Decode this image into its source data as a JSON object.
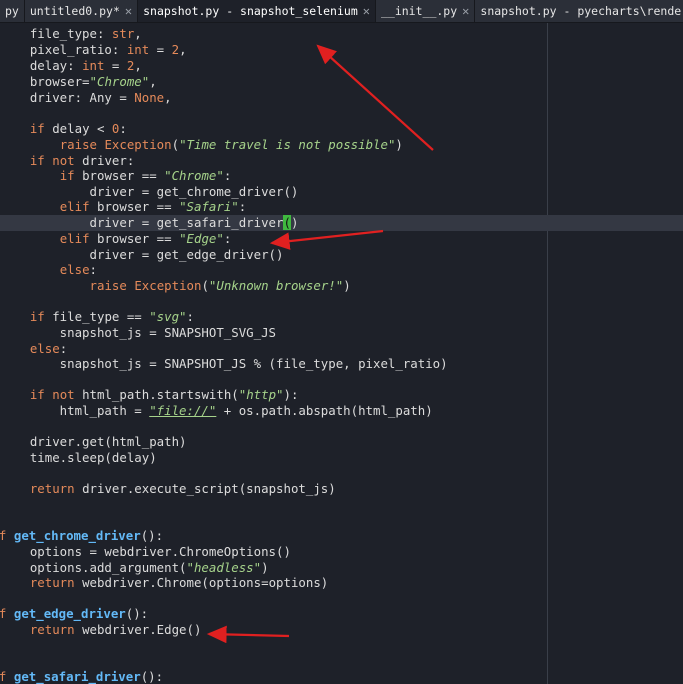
{
  "tabs": [
    {
      "label": "py",
      "active": false
    },
    {
      "label": "untitled0.py*",
      "active": false
    },
    {
      "label": "snapshot.py - snapshot_selenium",
      "active": true
    },
    {
      "label": "__init__.py",
      "active": false
    },
    {
      "label": "snapshot.py - pyecharts\\render",
      "active": false
    }
  ],
  "close_glyph": "✕",
  "colors": {
    "background": "#1e2129",
    "keyword": "#e58a5a",
    "function_name": "#63b9f7",
    "string": "#a6d38b",
    "text": "#dcdcdc",
    "annotation_arrow": "#e02020"
  },
  "code": {
    "l1": {
      "pre": "    file_type: ",
      "k1": "str",
      "post": ","
    },
    "l2": {
      "pre": "    pixel_ratio: ",
      "k1": "int",
      "mid": " = ",
      "n1": "2",
      "post": ","
    },
    "l3": {
      "pre": "    delay: ",
      "k1": "int",
      "mid": " = ",
      "n1": "2",
      "post": ","
    },
    "l4": {
      "pre": "    browser=",
      "s1": "\"Chrome\"",
      "post": ","
    },
    "l5": {
      "pre": "    driver: Any = ",
      "k1": "None",
      "post": ","
    },
    "l6": {
      "pre": "):"
    },
    "l7": {
      "pre": "    ",
      "k1": "if",
      "mid": " delay < ",
      "n1": "0",
      "post": ":"
    },
    "l8": {
      "pre": "        ",
      "k1": "raise",
      "mid": " ",
      "k2": "Exception",
      "mid2": "(",
      "s1": "\"Time travel is not possible\"",
      "post": ")"
    },
    "l9": {
      "pre": "    ",
      "k1": "if",
      "mid": " ",
      "k2": "not",
      "post": " driver:"
    },
    "l10": {
      "pre": "        ",
      "k1": "if",
      "mid": " browser == ",
      "s1": "\"Chrome\"",
      "post": ":"
    },
    "l11": {
      "pre": "            driver = get_chrome_driver()"
    },
    "l12": {
      "pre": "        ",
      "k1": "elif",
      "mid": " browser == ",
      "s1": "\"Safari\"",
      "post": ":"
    },
    "l13": {
      "pre": "            driver = get_safari_driver",
      "match": "(",
      "post": ")"
    },
    "l14": {
      "pre": "        ",
      "k1": "elif",
      "mid": " browser == ",
      "s1": "\"Edge\"",
      "post": ":"
    },
    "l15": {
      "pre": "            driver = get_edge_driver()"
    },
    "l16": {
      "pre": "        ",
      "k1": "else",
      "post": ":"
    },
    "l17": {
      "pre": "            ",
      "k1": "raise",
      "mid": " ",
      "k2": "Exception",
      "mid2": "(",
      "s1": "\"Unknown browser!\"",
      "post": ")"
    },
    "l18": {
      "pre": "    ",
      "k1": "if",
      "mid": " file_type == ",
      "s1": "\"svg\"",
      "post": ":"
    },
    "l19": {
      "pre": "        snapshot_js = SNAPSHOT_SVG_JS"
    },
    "l20": {
      "pre": "    ",
      "k1": "else",
      "post": ":"
    },
    "l21": {
      "pre": "        snapshot_js = SNAPSHOT_JS % (file_type, pixel_ratio)"
    },
    "l22": {
      "pre": "    ",
      "k1": "if",
      "mid": " ",
      "k2": "not",
      "post": " html_path.startswith(",
      "s1": "\"http\"",
      "post2": "):"
    },
    "l23": {
      "pre": "        html_path = ",
      "s1": "\"file://\"",
      "post": " + os.path.abspath(html_path)"
    },
    "l24": {
      "pre": "    driver.get(html_path)"
    },
    "l25": {
      "pre": "    time.sleep(delay)"
    },
    "l26": {
      "pre": "    ",
      "k1": "return",
      "post": " driver.execute_script(snapshot_js)"
    },
    "l27": {
      "pre": "def",
      "mid": " ",
      "f1": "get_chrome_driver",
      "post": "():"
    },
    "l28": {
      "pre": "    options = webdriver.ChromeOptions()"
    },
    "l29": {
      "pre": "    options.add_argument(",
      "s1": "\"headless\"",
      "post": ")"
    },
    "l30": {
      "pre": "    ",
      "k1": "return",
      "post": " webdriver.Chrome(options=options)"
    },
    "l31": {
      "pre": "def",
      "mid": " ",
      "f1": "get_edge_driver",
      "post": "():"
    },
    "l32": {
      "pre": "    ",
      "k1": "return",
      "post": " webdriver.Edge()"
    },
    "l33": {
      "pre": "def",
      "mid": " ",
      "f1": "get_safari_driver",
      "post": "():"
    }
  }
}
